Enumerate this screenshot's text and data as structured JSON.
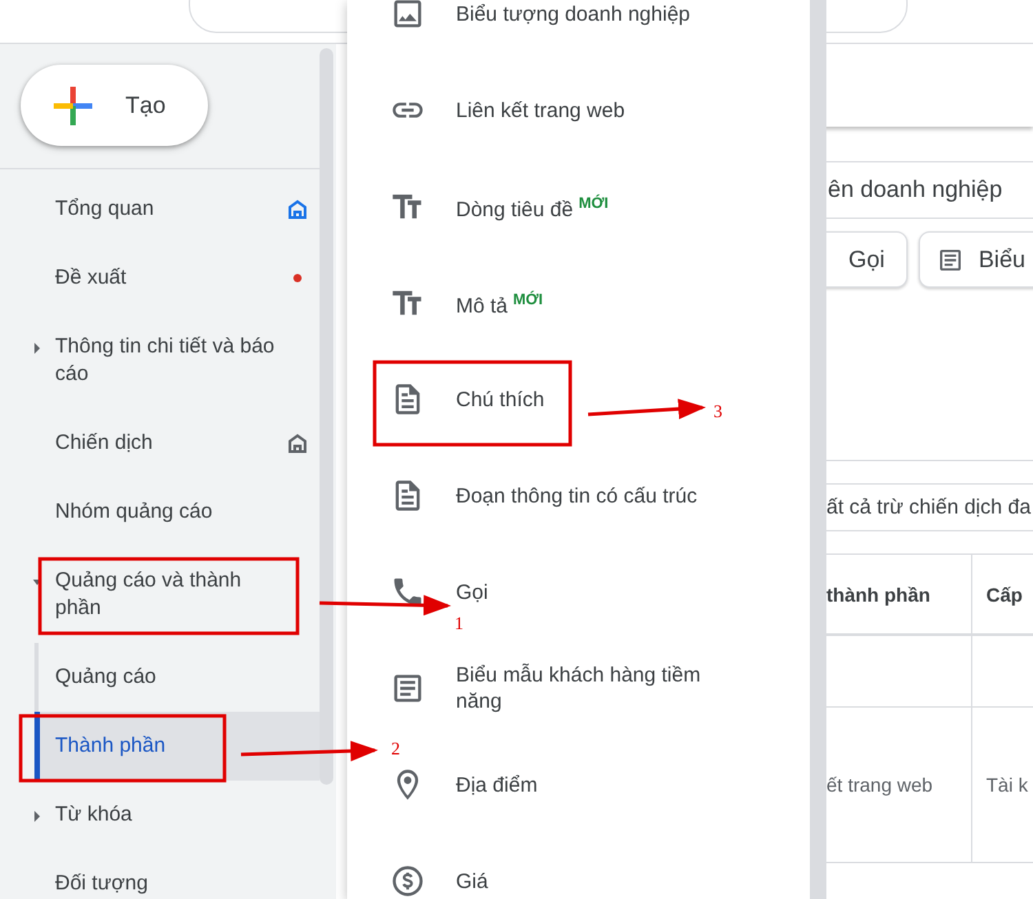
{
  "create_button": {
    "label": "Tạo"
  },
  "sidebar": {
    "items": [
      {
        "label": "Tổng quan",
        "marker": {
          "kind": "home",
          "color": "#1a73e8"
        }
      },
      {
        "label": "Đề xuất",
        "marker": {
          "kind": "dot",
          "color": "#d93025"
        }
      },
      {
        "label": "Thông tin chi tiết và báo cáo",
        "expanded": false
      },
      {
        "label": "Chiến dịch",
        "marker": {
          "kind": "home",
          "color": "#5f6368"
        }
      },
      {
        "label": "Nhóm quảng cáo"
      },
      {
        "label": "Quảng cáo và thành phần",
        "expanded": true,
        "children": [
          {
            "label": "Quảng cáo",
            "selected": false
          },
          {
            "label": "Thành phần",
            "selected": true
          }
        ]
      },
      {
        "label": "Từ khóa",
        "expanded": false
      },
      {
        "label": "Đối tượng"
      }
    ]
  },
  "menu": {
    "items": [
      {
        "label": "Biểu tượng doanh nghiệp",
        "kind": "image"
      },
      {
        "label": "Liên kết trang web",
        "kind": "link"
      },
      {
        "label": "Dòng tiêu đề",
        "kind": "text",
        "badge": "MỚI"
      },
      {
        "label": "Mô tả",
        "kind": "text",
        "badge": "MỚI"
      },
      {
        "label": "Chú thích",
        "kind": "doc"
      },
      {
        "label": "Đoạn thông tin có cấu trúc",
        "kind": "doc"
      },
      {
        "label": "Gọi",
        "kind": "phone"
      },
      {
        "label": "Biểu mẫu khách hàng tiềm năng",
        "kind": "form"
      },
      {
        "label": "Địa điểm",
        "kind": "pin"
      },
      {
        "label": "Giá",
        "kind": "dollar"
      }
    ]
  },
  "main": {
    "field_value": "ên doanh nghiệp",
    "chips": [
      {
        "label": "Gọi",
        "kind": "plain"
      },
      {
        "label": "Biểu",
        "kind": "form"
      }
    ],
    "filter_text": "ất cả trừ chiến dịch đa",
    "table": {
      "columns": [
        "thành phần",
        "Cấp"
      ],
      "rows": [
        [
          "ết trang web",
          "Tài k"
        ]
      ]
    }
  },
  "annotations": [
    {
      "number": "1"
    },
    {
      "number": "2"
    },
    {
      "number": "3"
    }
  ]
}
